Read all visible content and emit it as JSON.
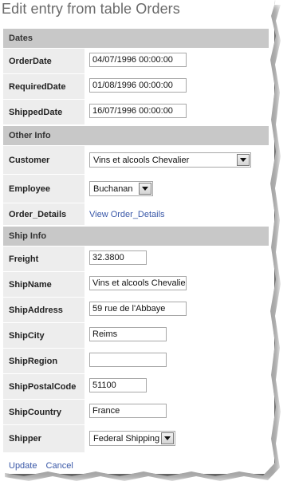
{
  "title": "Edit entry from table Orders",
  "sections": {
    "dates": {
      "header": "Dates",
      "order_date": {
        "label": "OrderDate",
        "value": "04/07/1996 00:00:00"
      },
      "required_date": {
        "label": "RequiredDate",
        "value": "01/08/1996 00:00:00"
      },
      "shipped_date": {
        "label": "ShippedDate",
        "value": "16/07/1996 00:00:00"
      }
    },
    "other": {
      "header": "Other Info",
      "customer": {
        "label": "Customer",
        "value": "Vins et alcools Chevalier"
      },
      "employee": {
        "label": "Employee",
        "value": "Buchanan"
      },
      "order_details": {
        "label": "Order_Details",
        "link": "View Order_Details"
      }
    },
    "ship": {
      "header": "Ship Info",
      "freight": {
        "label": "Freight",
        "value": "32.3800"
      },
      "ship_name": {
        "label": "ShipName",
        "value": "Vins et alcools Chevalier"
      },
      "ship_address": {
        "label": "ShipAddress",
        "value": "59 rue de l'Abbaye"
      },
      "ship_city": {
        "label": "ShipCity",
        "value": "Reims"
      },
      "ship_region": {
        "label": "ShipRegion",
        "value": ""
      },
      "ship_postal_code": {
        "label": "ShipPostalCode",
        "value": "51100"
      },
      "ship_country": {
        "label": "ShipCountry",
        "value": "France"
      },
      "shipper": {
        "label": "Shipper",
        "value": "Federal Shipping"
      }
    }
  },
  "actions": {
    "update": "Update",
    "cancel": "Cancel"
  },
  "colors": {
    "section_header_bg": "#c8c8c8",
    "label_bg": "#ededed",
    "link": "#3a58a8"
  }
}
